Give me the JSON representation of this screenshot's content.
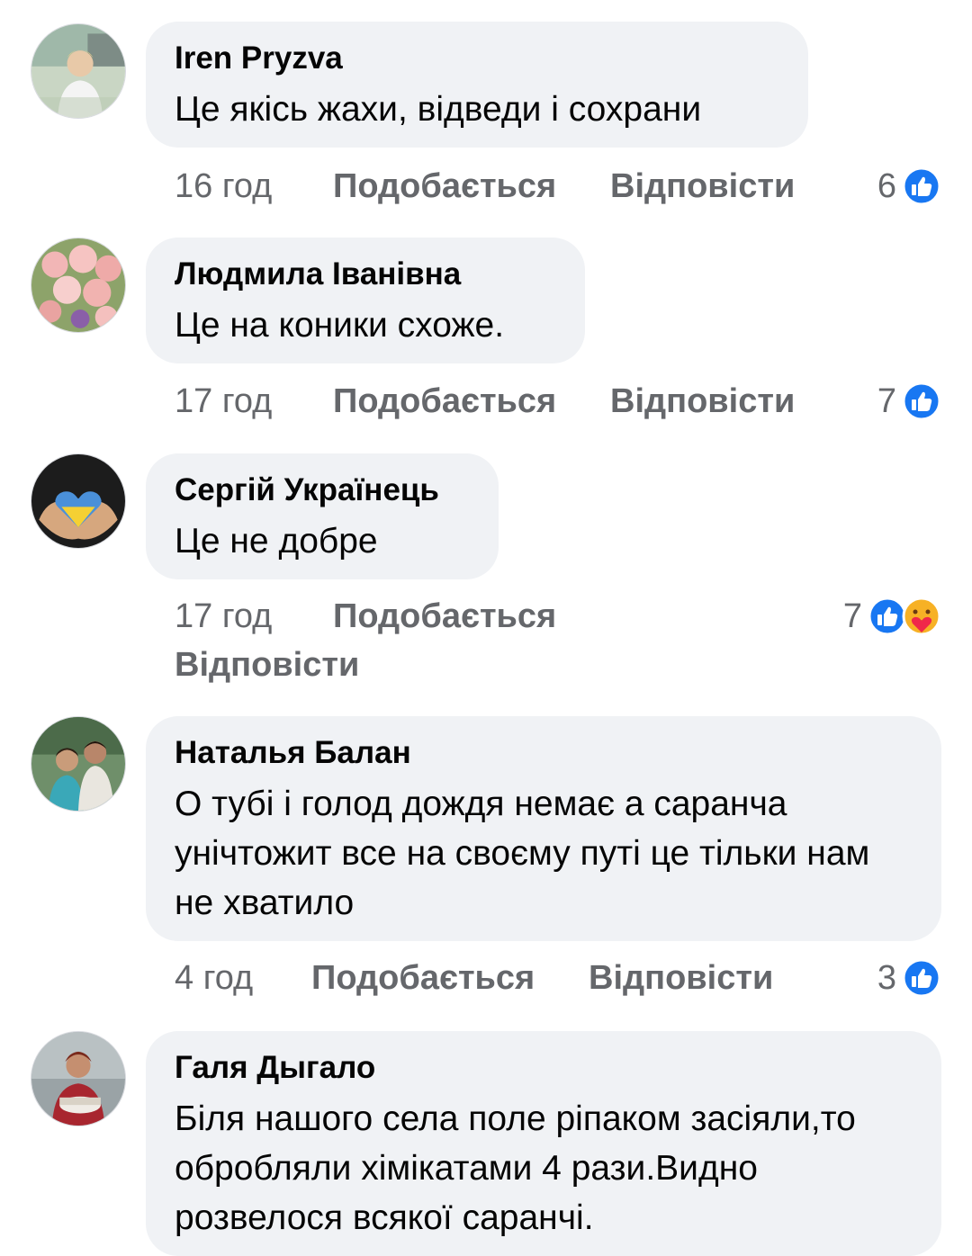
{
  "actions": {
    "like": "Подобається",
    "reply": "Відповісти"
  },
  "colors": {
    "like_blue": "#1877f2",
    "bubble": "#f0f2f5",
    "muted": "#65676b"
  },
  "comments": [
    {
      "author": "Iren Pryzva",
      "text": "Це якісь жахи, відведи і сохрани",
      "time": "16 год",
      "reactions": "6",
      "reaction_icons": [
        "like-icon"
      ]
    },
    {
      "author": "Людмила Іванівна",
      "text": "Це на коники схоже.",
      "time": "17 год",
      "reactions": "7",
      "reaction_icons": [
        "like-icon"
      ]
    },
    {
      "author": "Сергій Українець",
      "text": "Це не добре",
      "time": "17 год",
      "reactions": "7",
      "reaction_icons": [
        "like-icon",
        "care-icon"
      ]
    },
    {
      "author": "Наталья Балан",
      "text": "О тубі і голод дождя немає а саранча унічтожит все на своєму путі це тільки нам не хватило",
      "time": "4 год",
      "reactions": "3",
      "reaction_icons": [
        "like-icon"
      ]
    },
    {
      "author": "Галя Дыгало",
      "text": "Біля нашого села поле ріпаком засіяли,то обробляли хімікатами 4 рази.Видно розвелося всякої саранчі.",
      "time": "",
      "reactions": "",
      "reaction_icons": []
    }
  ]
}
